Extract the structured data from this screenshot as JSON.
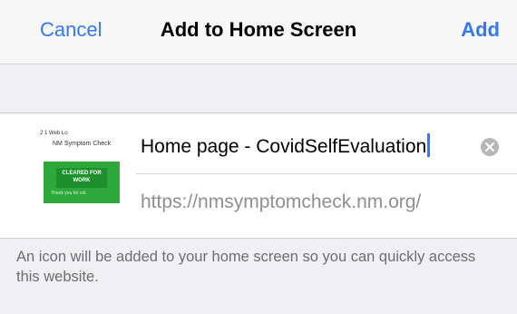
{
  "navbar": {
    "cancel_label": "Cancel",
    "title": "Add to Home Screen",
    "add_label": "Add"
  },
  "thumbnail": {
    "line1": "2 1 Web Lo",
    "line2": "NM Symptom Check",
    "badge": "CLEARED FOR WORK",
    "subtext": "Thank you for col"
  },
  "form": {
    "name_value": "Home page - CovidSelfEvaluation",
    "clear_icon": "clear-icon",
    "url": "https://nmsymptomcheck.nm.org/"
  },
  "footnote": "An icon will be added to your home screen so you can quickly access this website.",
  "colors": {
    "accent": "#3478f6",
    "background": "#efeff4",
    "thumbnail_green": "#2fa83b"
  }
}
